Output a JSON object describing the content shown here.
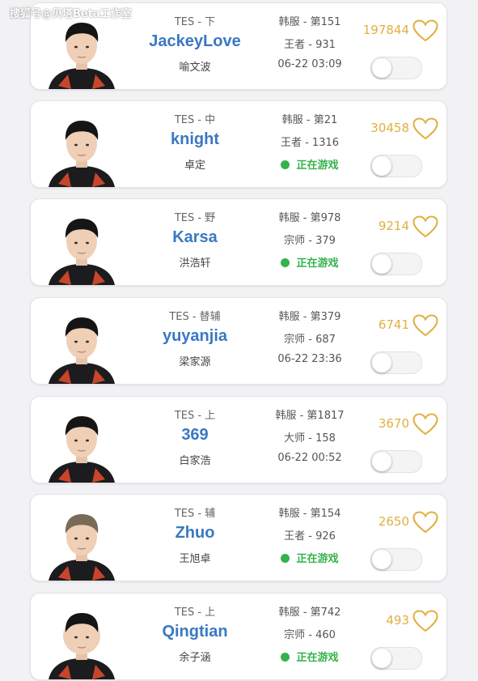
{
  "watermark": "搜狐号@贝塔Beta工作室",
  "colors": {
    "accent_name": "#3a78c2",
    "like": "#e0b040",
    "live": "#34b34a"
  },
  "icons": {
    "like": "heart-outline-icon",
    "live": "green-dot-icon",
    "follow": "toggle-switch"
  },
  "players": [
    {
      "team": "TES - 下",
      "ign": "JackeyLove",
      "name": "喻文波",
      "server": "韩服 - 第151",
      "rank": "王者 - 931",
      "status": "06-22 03:09",
      "live": false,
      "likes": "197844"
    },
    {
      "team": "TES - 中",
      "ign": "knight",
      "name": "卓定",
      "server": "韩服 - 第21",
      "rank": "王者 - 1316",
      "status": "正在游戏",
      "live": true,
      "likes": "30458"
    },
    {
      "team": "TES - 野",
      "ign": "Karsa",
      "name": "洪浩轩",
      "server": "韩服 - 第978",
      "rank": "宗师 - 379",
      "status": "正在游戏",
      "live": true,
      "likes": "9214"
    },
    {
      "team": "TES - 替辅",
      "ign": "yuyanjia",
      "name": "梁家源",
      "server": "韩服 - 第379",
      "rank": "宗师 - 687",
      "status": "06-22 23:36",
      "live": false,
      "likes": "6741"
    },
    {
      "team": "TES - 上",
      "ign": "369",
      "name": "白家浩",
      "server": "韩服 - 第1817",
      "rank": "大师 - 158",
      "status": "06-22 00:52",
      "live": false,
      "likes": "3670"
    },
    {
      "team": "TES - 辅",
      "ign": "Zhuo",
      "name": "王旭卓",
      "server": "韩服 - 第154",
      "rank": "王者 - 926",
      "status": "正在游戏",
      "live": true,
      "likes": "2650"
    },
    {
      "team": "TES - 上",
      "ign": "Qingtian",
      "name": "余子涵",
      "server": "韩服 - 第742",
      "rank": "宗师 - 460",
      "status": "正在游戏",
      "live": true,
      "likes": "493"
    }
  ]
}
